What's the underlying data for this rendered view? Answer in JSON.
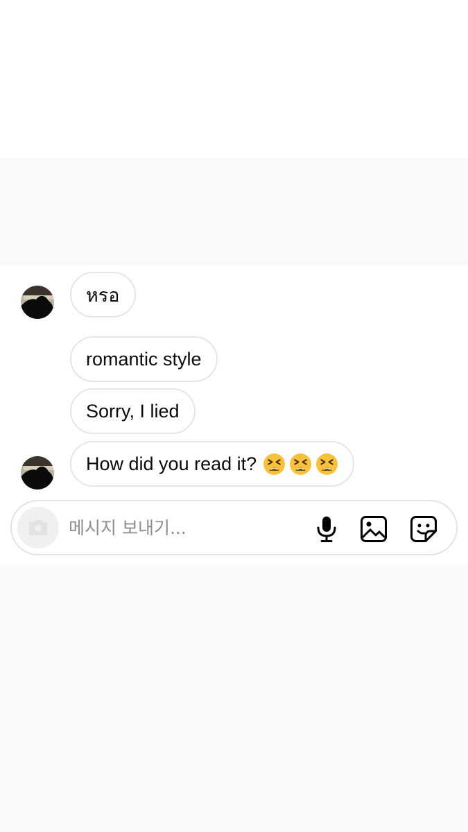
{
  "messages": [
    {
      "text": "หรอ",
      "has_avatar": true
    },
    {
      "text": "romantic style",
      "has_avatar": false
    },
    {
      "text": "Sorry, I lied",
      "has_avatar": false
    },
    {
      "text": "How did you read it?",
      "emoji": [
        "tired-face-emoji",
        "tired-face-emoji",
        "tired-face-emoji"
      ],
      "has_avatar": true
    }
  ],
  "composer": {
    "placeholder": "메시지 보내기...",
    "icons": [
      "camera-icon",
      "microphone-icon",
      "gallery-icon",
      "sticker-icon"
    ]
  },
  "colors": {
    "bubble_border": "#e6e6e6",
    "text": "#0a0a0a",
    "placeholder": "#8e8e8e",
    "background": "#fafafa",
    "emoji_face": "#f7c23a"
  }
}
